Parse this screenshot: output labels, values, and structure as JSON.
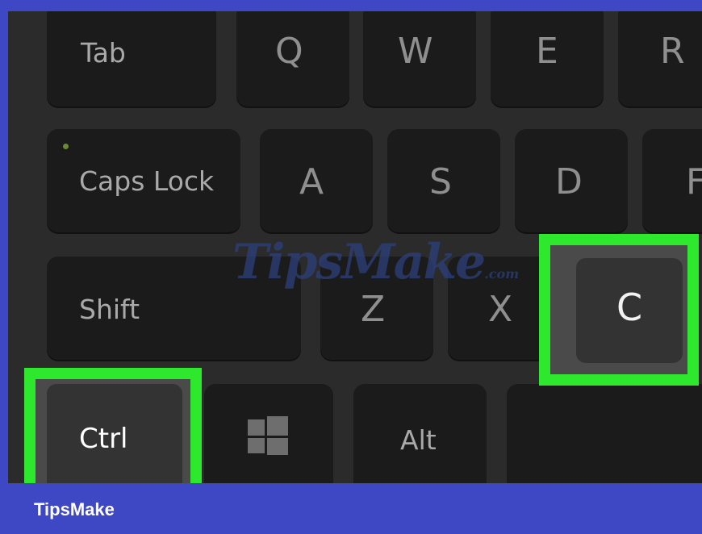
{
  "keys": {
    "tab": "Tab",
    "q": "Q",
    "w": "W",
    "e": "E",
    "r": "R",
    "caps_lock": "Caps Lock",
    "a": "A",
    "s": "S",
    "d": "D",
    "f": "F",
    "shift": "Shift",
    "z": "Z",
    "x": "X",
    "c": "C",
    "ctrl": "Ctrl",
    "alt": "Alt"
  },
  "watermark": {
    "text": "TipsMake",
    "suffix": ".com"
  },
  "footer": {
    "brand": "TipsMake"
  },
  "colors": {
    "highlight": "#2ee82e",
    "footer_bg": "#3f48c4",
    "keyboard_bg": "#2b2b2b",
    "key_bg": "#1b1b1b"
  },
  "icons": {
    "windows_key": "windows-logo-icon"
  }
}
